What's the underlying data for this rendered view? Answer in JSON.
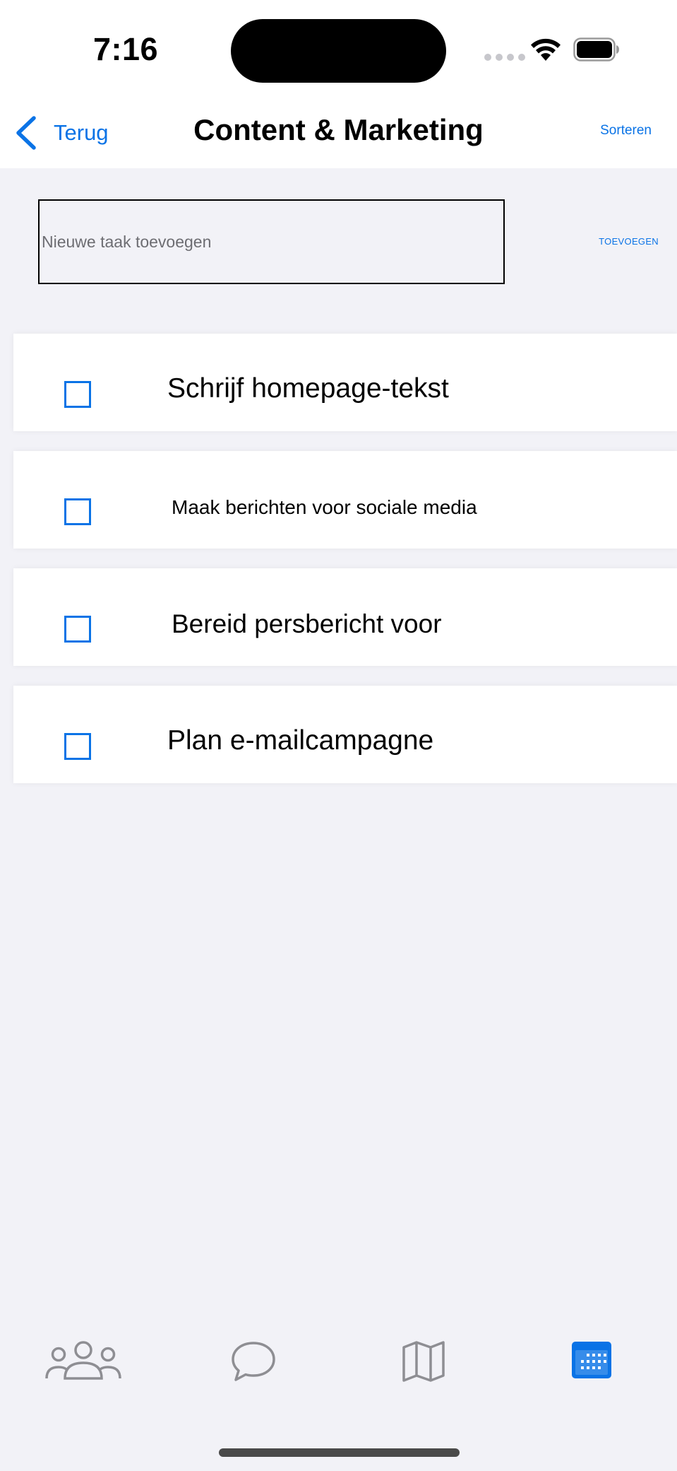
{
  "status_bar": {
    "time": "7:16"
  },
  "nav": {
    "back_label": "Terug",
    "title": "Content & Marketing",
    "sort_label": "Sorteren"
  },
  "add_task": {
    "placeholder": "Nieuwe taak toevoegen",
    "value": "",
    "add_label": "TOEVOEGEN"
  },
  "tasks": [
    {
      "label": "Schrijf homepage-tekst",
      "checked": false
    },
    {
      "label": "Maak berichten voor sociale media",
      "checked": false
    },
    {
      "label": "Bereid persbericht voor",
      "checked": false
    },
    {
      "label": "Plan e-mailcampagne",
      "checked": false
    }
  ],
  "tab_bar": {
    "tabs": [
      {
        "icon": "people-icon",
        "active": false
      },
      {
        "icon": "chat-bubble-icon",
        "active": false
      },
      {
        "icon": "map-icon",
        "active": false
      },
      {
        "icon": "calendar-icon",
        "active": true
      }
    ]
  },
  "colors": {
    "accent": "#0a73e6",
    "background": "#f2f2f7",
    "inactive_icon": "#8e8e93"
  }
}
